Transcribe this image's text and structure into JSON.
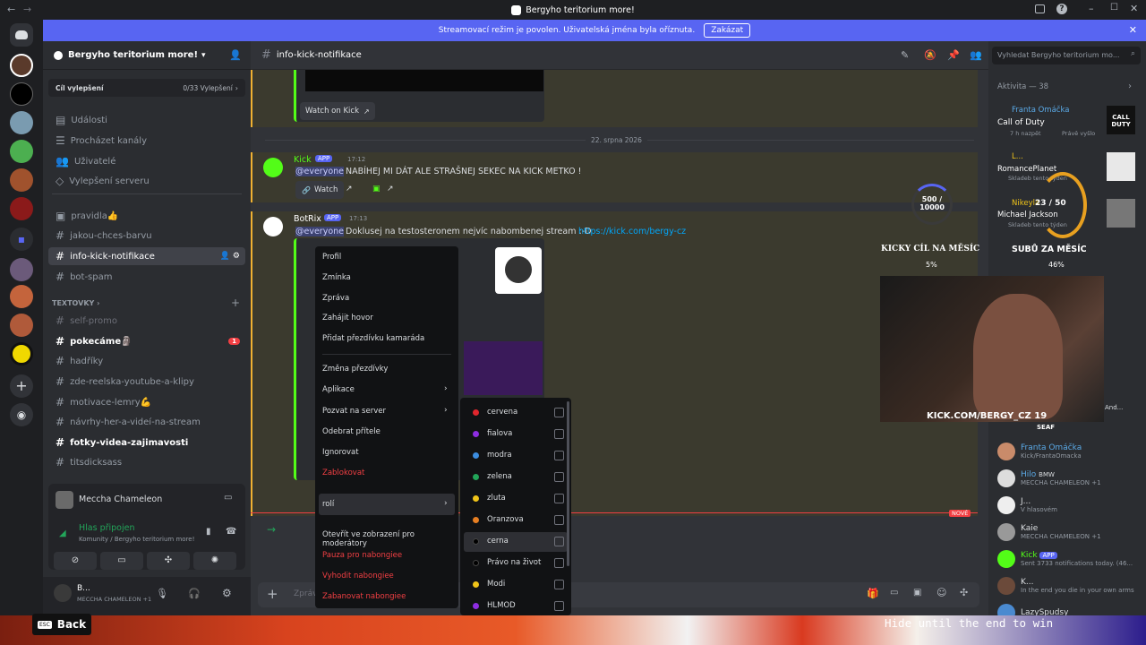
{
  "titlebar": {
    "title": "Bergyho teritorium more!"
  },
  "banner": {
    "text": "Streamovací režim je povolen. Uživatelská jména byla oříznuta.",
    "button": "Zakázat"
  },
  "server": {
    "name": "Bergyho teritorium more!",
    "boost_label": "Cíl vylepšení",
    "boost_count": "0/33 Vylepšení"
  },
  "nav": [
    "Události",
    "Procházet kanály",
    "Uživatelé",
    "Vylepšení serveru"
  ],
  "channels_top": [
    "pravidla👍",
    "jakou-chces-barvu",
    "info-kick-notifikace",
    "bot-spam"
  ],
  "category": "TEXTOVKY",
  "channels_text": [
    "self-promo",
    "pokecáme🗿",
    "hadříky",
    "zde-reelska-youtube-a-klipy",
    "motivace-lemry💪",
    "návrhy-her-a-videí-na-stream",
    "fotky-videa-zajimavosti",
    "titsdicksass"
  ],
  "unread_badge": "1",
  "voice": {
    "user": "Meccha Chameleon",
    "status": "Hlas připojen",
    "location": "Komunity / Bergyho teritorium more!"
  },
  "me": {
    "name": "B...",
    "status": "MECCHA CHAMELEON +1"
  },
  "header": {
    "channel": "info-kick-notifikace",
    "search": "Vyhledat Bergyho teritorium mo..."
  },
  "chat": {
    "watch_kick": "Watch on Kick",
    "date": "22. srpna 2026",
    "m1": {
      "author": "Kick",
      "badge": "APP",
      "time": "17:12",
      "mention": "@everyone",
      "text": "NABÍHEJ MI DÁT ALE STRAŠNEJ SEKEC NA KICK METKO !",
      "watch": "Watch"
    },
    "m2": {
      "author": "BotRix",
      "badge": "APP",
      "time": "17:13",
      "mention": "@everyone",
      "text": "Doklusej na testosteronem nejvíc nabombenej stream :-D",
      "link": "https://kick.com/bergy-cz"
    },
    "new_label": "NOVÉ",
    "input_placeholder": "Zpráva"
  },
  "context_menu": [
    "Profil",
    "Zmínka",
    "Zpráva",
    "Zahájit hovor",
    "Přidat přezdívku kamaráda",
    "Změna přezdívky",
    "Aplikace",
    "Pozvat na server",
    "Odebrat přítele",
    "Ignorovat",
    "Zablokovat",
    "rolí",
    "Otevřít ve zobrazení pro moderátory",
    "Pauza pro nabongiee",
    "Vyhodit nabongiee",
    "Zabanovat nabongiee"
  ],
  "roles": [
    {
      "name": "cervena",
      "color": "#e0262d"
    },
    {
      "name": "fialova",
      "color": "#8e2de2"
    },
    {
      "name": "modra",
      "color": "#3c8de0"
    },
    {
      "name": "zelena",
      "color": "#22a559"
    },
    {
      "name": "zluta",
      "color": "#f0c419"
    },
    {
      "name": "Oranzova",
      "color": "#e67e22"
    },
    {
      "name": "cerna",
      "color": "#000000"
    },
    {
      "name": "Právo na život",
      "color": "#000000"
    },
    {
      "name": "Modi",
      "color": "#f0c419"
    },
    {
      "name": "HLMOD",
      "color": "#8e2de2"
    }
  ],
  "members": {
    "activity": "Aktivita — 38",
    "a1": {
      "user": "Franta Omáčka",
      "game": "Call of Duty",
      "meta": "7 h nazpět",
      "meta2": "Právě vyšlo"
    },
    "a2": {
      "user": "L...",
      "game": "RomancePlanet",
      "meta": "Skladeb tento týden"
    },
    "a3": {
      "user": "Nikeyla",
      "game": "Michael Jackson",
      "meta": "Skladeb tento týden"
    },
    "list": [
      {
        "name": "Franta Omáčka",
        "sub": "Kick/FrantaOmacka"
      },
      {
        "name": "Hilo",
        "sub": "MECCHA CHAMELEON +1",
        "tag": "BMW"
      },
      {
        "name": "J...",
        "sub": "V hlasovém"
      },
      {
        "name": "Kaie",
        "sub": "MECCHA CHAMELEON +1"
      },
      {
        "name": "Kick",
        "sub": "Sent 3733 notifications today. (46...",
        "tag": "APP"
      },
      {
        "name": "K...",
        "sub": "In the end you die in your own arms"
      },
      {
        "name": "LazySpudsy",
        "sub": ""
      }
    ]
  },
  "overlay": {
    "counter": "500 / 10000",
    "goal_title": "KICKY CÍL NA MĚSÍC",
    "goal_pct": "5%",
    "subs_count": "23 / 50",
    "subs_title": "SUBŮ ZA MĚSÍC",
    "subs_pct": "46%",
    "cam_text": "KICK.COM/BERGY_CZ 19",
    "seaf": "SEAF",
    "and": "And..."
  },
  "footer": {
    "back": "Back",
    "esc": "ESC",
    "hint": "Hide until the end to win"
  }
}
